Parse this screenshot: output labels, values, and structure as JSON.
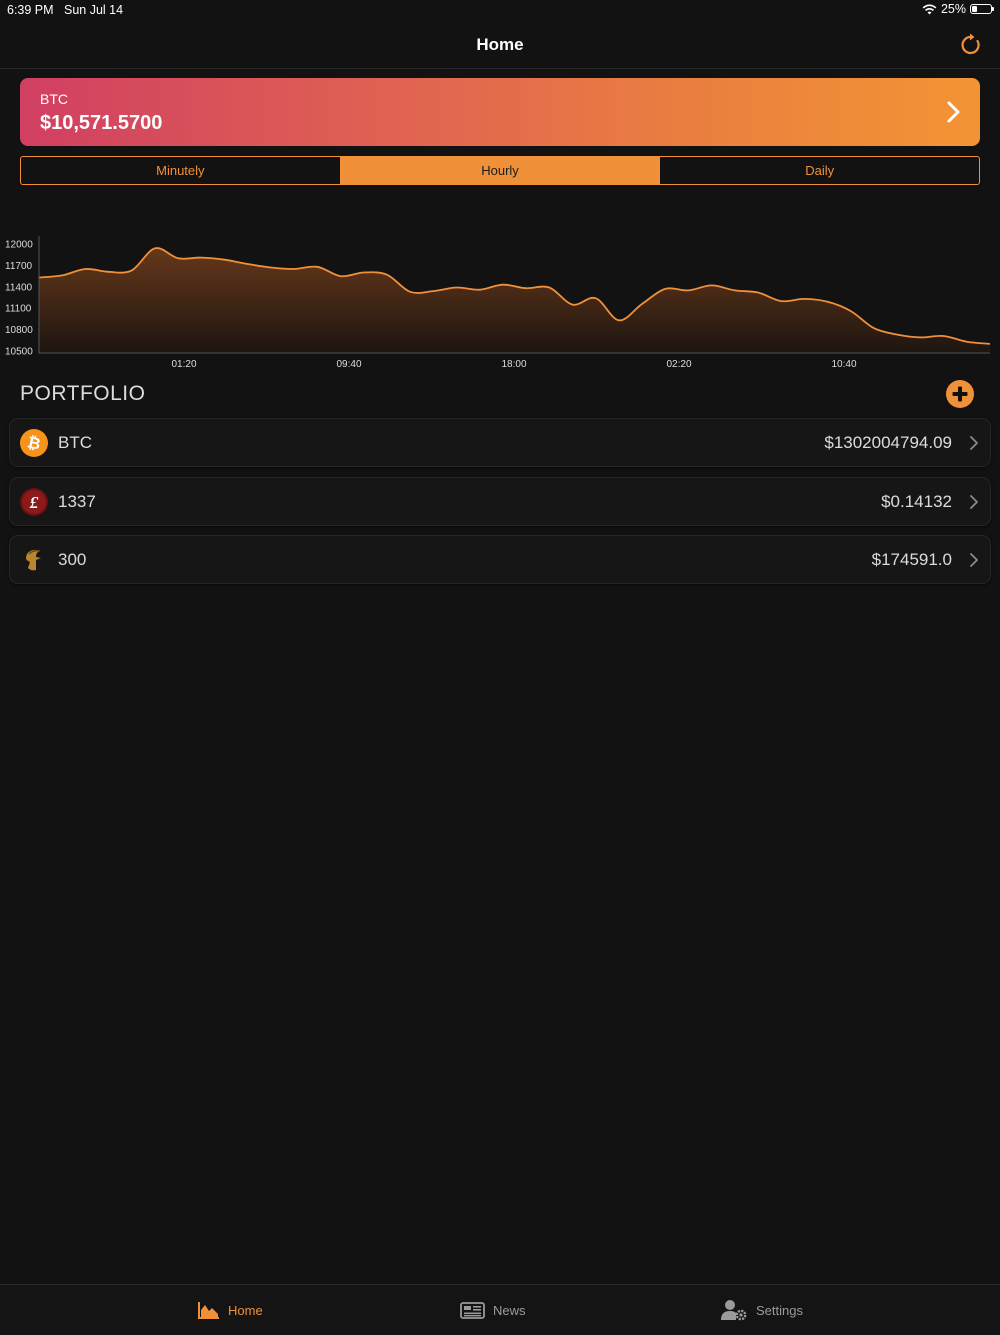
{
  "status_bar": {
    "time": "6:39 PM",
    "date": "Sun Jul 14",
    "battery": "25%",
    "battery_level": 0.25
  },
  "nav": {
    "title": "Home"
  },
  "price_card": {
    "symbol": "BTC",
    "price": "$10,571.5700"
  },
  "segments": [
    {
      "label": "Minutely",
      "active": false
    },
    {
      "label": "Hourly",
      "active": true
    },
    {
      "label": "Daily",
      "active": false
    }
  ],
  "chart_data": {
    "type": "area",
    "title": "",
    "xlabel": "",
    "ylabel": "",
    "y_ticks": [
      12000,
      11700,
      11400,
      11100,
      10800,
      10500
    ],
    "x_ticks": [
      "01:20",
      "09:40",
      "18:00",
      "02:20",
      "10:40"
    ],
    "ylim": [
      10500,
      12000
    ],
    "grid": false,
    "line_color": "#f0913a",
    "series": [
      {
        "values": [
          11530,
          11560,
          11650,
          11610,
          11630,
          11940,
          11800,
          11810,
          11780,
          11720,
          11670,
          11650,
          11680,
          11550,
          11600,
          11570,
          11330,
          11340,
          11390,
          11360,
          11430,
          11380,
          11390,
          11150,
          11240,
          10930,
          11160,
          11370,
          11350,
          11420,
          11350,
          11320,
          11200,
          11230,
          11190,
          11060,
          10820,
          10730,
          10690,
          10710,
          10630,
          10600
        ]
      }
    ]
  },
  "portfolio": {
    "title": "PORTFOLIO",
    "items": [
      {
        "icon": "bitcoin-icon",
        "amount": "BTC",
        "value": "$1302004794.09"
      },
      {
        "icon": "elite-coin-icon",
        "amount": "1337",
        "value": "$0.14132"
      },
      {
        "icon": "spartan-helmet-icon",
        "amount": "300",
        "value": "$174591.0"
      }
    ]
  },
  "tabs": [
    {
      "label": "Home",
      "icon": "chart-area-icon",
      "active": true
    },
    {
      "label": "News",
      "icon": "newspaper-icon",
      "active": false
    },
    {
      "label": "Settings",
      "icon": "user-settings-icon",
      "active": false
    }
  ],
  "colors": {
    "accent": "#f0913a",
    "background": "#121212",
    "card_gradient_start": "#d13f62",
    "card_gradient_end": "#f39434"
  }
}
